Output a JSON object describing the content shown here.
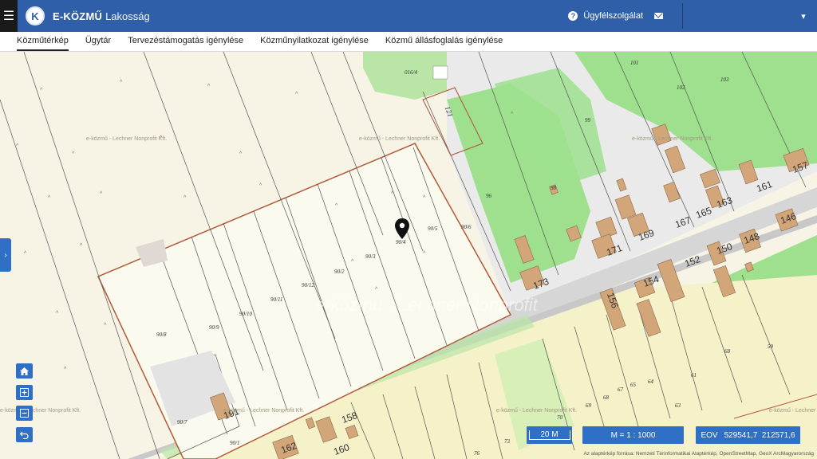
{
  "app": {
    "brand_bold": "E-KÖZMŰ",
    "brand_light": "Lakosság",
    "logo_letter": "K",
    "support_label": "Ügyfélszolgálat"
  },
  "tabs": [
    {
      "label": "Közműtérkép",
      "active": true
    },
    {
      "label": "Ügytár"
    },
    {
      "label": "Tervezéstámogatás igénylése"
    },
    {
      "label": "Közműnyilatkozat igénylése"
    },
    {
      "label": "Közmű állásfoglalás igénylése"
    }
  ],
  "map": {
    "scale_bar": "20 M",
    "ratio": "M = 1 : 1000",
    "coord_label": "EOV",
    "coord_x": "529541,7",
    "coord_y": "212571,6",
    "attribution": "Az alaptérkép forrása: Nemzeti Térinformatikai Alaptérkép, OpenStreetMap, GeoX ArcMagyarország",
    "watermark": "e-közmű - Lechner Nonprofit Kft.",
    "big_watermark": "e-közmű - Lechner Nonprofit",
    "parcels": [
      "016/4",
      "121",
      "99",
      "101",
      "102",
      "103",
      "96",
      "98",
      "90/4",
      "90/5",
      "90/6",
      "90/3",
      "90/2",
      "90/12",
      "90/11",
      "90/10",
      "90/9",
      "90/8",
      "90/7",
      "90/1"
    ],
    "house_numbers": [
      "157",
      "161",
      "163",
      "165",
      "167",
      "169",
      "171",
      "173",
      "146",
      "148",
      "150",
      "152",
      "154",
      "156",
      "158",
      "160",
      "162",
      "191"
    ],
    "green_numbers": [
      "68",
      "59",
      "61",
      "63",
      "64",
      "65",
      "67",
      "68",
      "69",
      "70",
      "73",
      "76"
    ]
  },
  "colors": {
    "topbar": "#2f5fa8",
    "control": "#2f6fc6",
    "map_bg": "#f7f4e6",
    "green": "#9ee08e",
    "road": "#d6d6d6",
    "building": "#d2a679"
  }
}
